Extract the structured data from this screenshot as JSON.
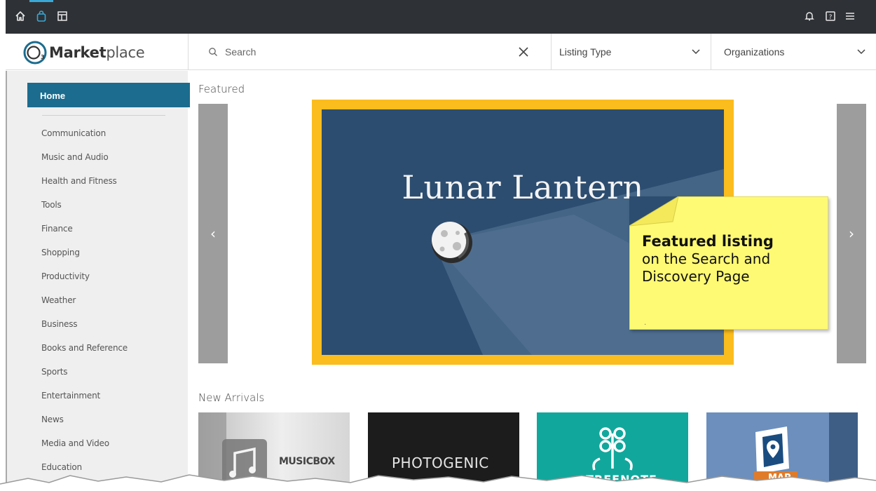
{
  "topbar": {
    "left_icons": [
      "home-icon",
      "bag-icon",
      "layout-icon"
    ],
    "right_icons": [
      "bell-icon",
      "help-icon",
      "menu-icon"
    ]
  },
  "header": {
    "logo_text_bold": "Market",
    "logo_text_light": "place",
    "logo_mark": "O3",
    "search_placeholder": "Search",
    "listing_type_label": "Listing Type",
    "organizations_label": "Organizations"
  },
  "sidebar": {
    "home": "Home",
    "categories": [
      "Communication",
      "Music and Audio",
      "Health and Fitness",
      "Tools",
      "Finance",
      "Shopping",
      "Productivity",
      "Weather",
      "Business",
      "Books and Reference",
      "Sports",
      "Entertainment",
      "News",
      "Media and Video",
      "Education"
    ]
  },
  "main": {
    "featured_title": "Featured",
    "featured_listing": "Lunar Lantern",
    "prev_arrow": "‹",
    "next_arrow": "›",
    "new_arrivals_title": "New Arrivals",
    "new_arrivals": [
      "MUSICBOX",
      "PHOTOGENIC",
      "TREENOTE",
      "MAP"
    ]
  },
  "callout": {
    "bold": "Featured listing",
    "line1": "on the Search and",
    "line2": "Discovery Page"
  },
  "colors": {
    "topbar": "#2e3236",
    "accent": "#1b6c8e",
    "featured_border": "#fbbc1d",
    "featured_bg": "#2d4d70",
    "note": "#fffa73"
  }
}
